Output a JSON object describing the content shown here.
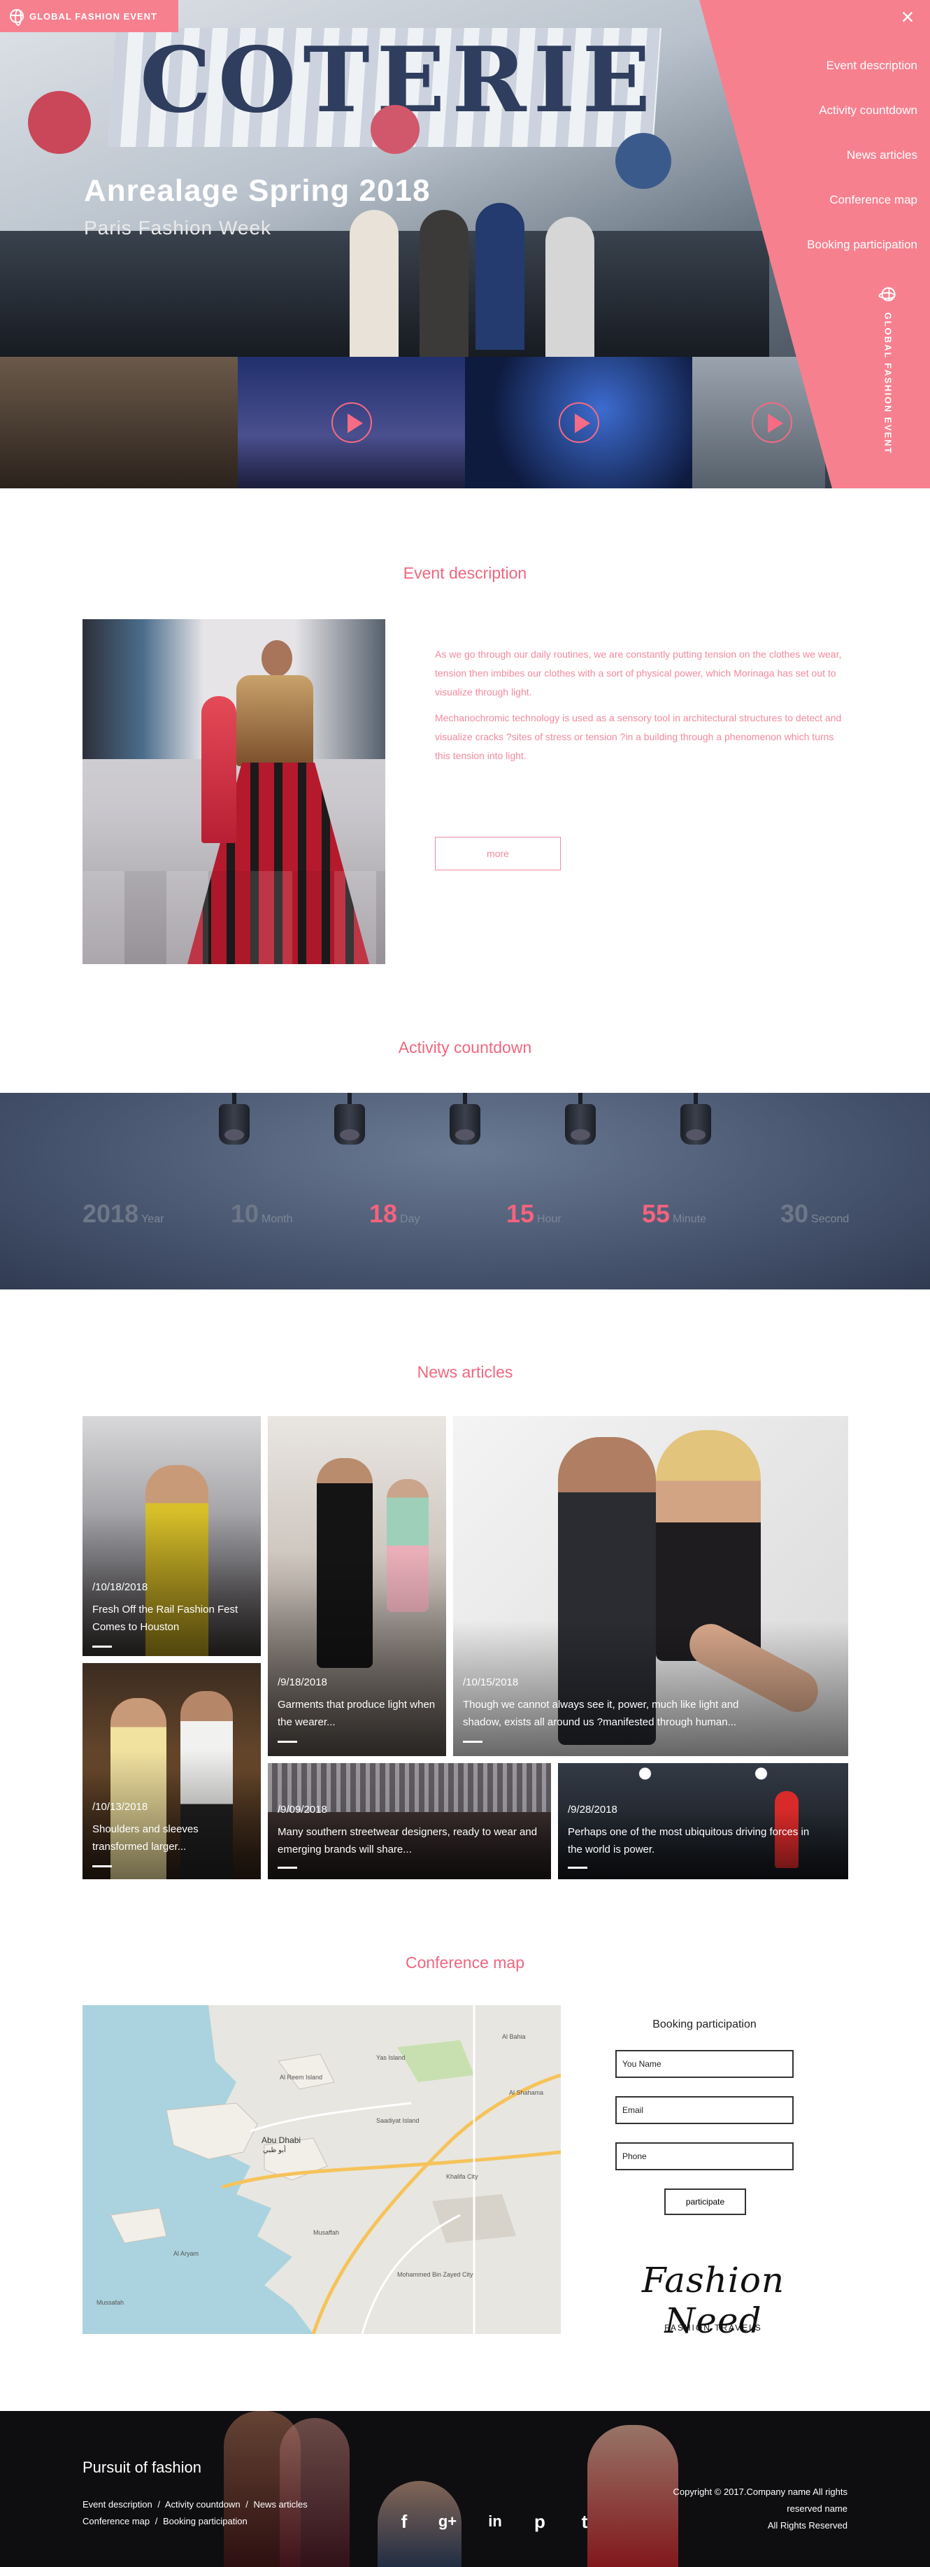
{
  "header": {
    "logo_text": "GLOBAL FASHION EVENT",
    "hero_title": "Anrealage Spring 2018",
    "hero_subtitle": "Paris Fashion Week",
    "banner_text": "COTERIE",
    "close_symbol": "×",
    "vertical_text": "GLOBAL FASHION EVENT"
  },
  "nav": {
    "items": [
      {
        "label": "Event description"
      },
      {
        "label": "Activity countdown"
      },
      {
        "label": "News articles"
      },
      {
        "label": "Conference map"
      },
      {
        "label": "Booking participation"
      }
    ]
  },
  "event": {
    "title": "Event description",
    "paragraph1": "As we go through our daily routines, we are constantly putting tension on the clothes we wear, tension then imbibes our clothes with a sort of physical power, which Morinaga has set out to visualize through light.",
    "paragraph2": "Mechanochromic technology is used as a sensory tool in architectural structures to detect and visualize cracks ?sites of stress or tension ?in a building through a phenomenon which turns this tension into light.",
    "more_label": "more"
  },
  "countdown": {
    "title": "Activity countdown",
    "units": [
      {
        "value": "2018",
        "label": "Year",
        "color": "#6e7788"
      },
      {
        "value": "10",
        "label": "Month",
        "color": "#6e7788"
      },
      {
        "value": "18",
        "label": "Day",
        "color": "#f4637e"
      },
      {
        "value": "15",
        "label": "Hour",
        "color": "#f4637e"
      },
      {
        "value": "55",
        "label": "Minute",
        "color": "#f4637e"
      },
      {
        "value": "30",
        "label": "Second",
        "color": "#6e7788"
      }
    ]
  },
  "news": {
    "title": "News articles",
    "articles": [
      {
        "date": "/10/18/2018",
        "text": "Fresh Off the Rail Fashion Fest Comes to Houston"
      },
      {
        "date": "/9/18/2018",
        "text": "Garments that produce light when the wearer..."
      },
      {
        "date": "/10/15/2018",
        "text": "Though we cannot always see it, power, much like light and shadow, exists all around us ?manifested through human..."
      },
      {
        "date": "/10/13/2018",
        "text": "Shoulders and sleeves transformed larger..."
      },
      {
        "date": "/9/09/2018",
        "text": "Many southern streetwear designers, ready to wear and emerging brands will share..."
      },
      {
        "date": "/9/28/2018",
        "text": "Perhaps one of the most ubiquitous driving forces in the world is power."
      }
    ]
  },
  "conference": {
    "title": "Conference map",
    "map_labels": [
      "Abu Dhabi",
      "أبو ظبي",
      "Al Reem Island",
      "Yas Island",
      "Khalifa City",
      "Saadiyat Island",
      "Al Aryam",
      "Musaffah",
      "Mohammed Bin Zayed City",
      "Al Bahia",
      "Al Shahama",
      "Mussafah"
    ]
  },
  "booking": {
    "title": "Booking participation",
    "name_placeholder": "You Name",
    "email_placeholder": "Email",
    "phone_placeholder": "Phone",
    "submit_label": "participate",
    "brand": "Fashion Need",
    "brand_sub": "FASHION TRAVELS"
  },
  "footer": {
    "title": "Pursuit of fashion",
    "links": [
      "Event description",
      "Activity countdown",
      "News articles",
      "Conference map",
      "Booking participation"
    ],
    "separator": "/",
    "copyright1": "Copyright © 2017.Company name All rights",
    "copyright2": "reserved name",
    "copyright3": "All Rights Reserved",
    "social_icons": [
      "facebook-icon",
      "google-plus-icon",
      "linkedin-icon",
      "pinterest-icon",
      "twitter-icon"
    ],
    "social_glyphs": [
      "f",
      "g+",
      "in",
      "p",
      "t"
    ]
  },
  "colors": {
    "accent": "#f7808f",
    "accent_text": "#f0677f",
    "countdown_bg": "#4a5771",
    "footer_bg": "#0e0e10"
  }
}
